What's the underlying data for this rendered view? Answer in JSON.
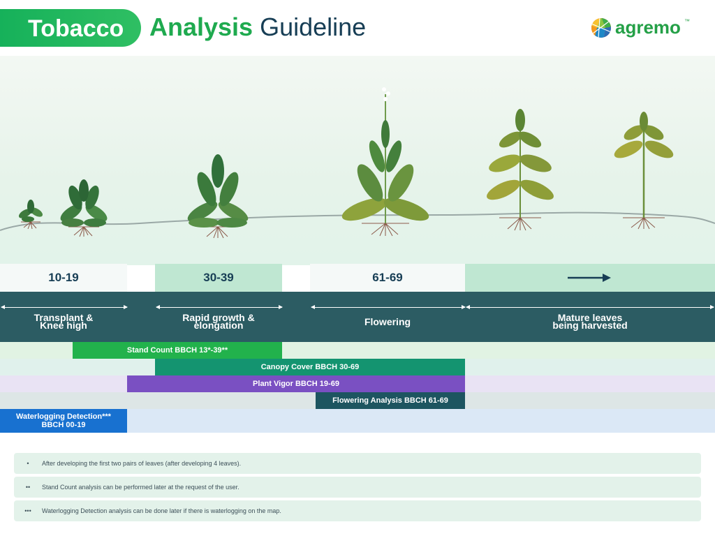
{
  "header": {
    "title_word1": "Tobacco",
    "title_word2": "Analysis",
    "title_word3": "Guideline",
    "logo_text": "agremo",
    "logo_tm": "™"
  },
  "stages": [
    {
      "code": "10-19",
      "label": "Transplant &\nKnee high"
    },
    {
      "code": "30-39",
      "label": "Rapid growth &\nelongation"
    },
    {
      "code": "61-69",
      "label": "Flowering"
    },
    {
      "code": "",
      "label": "Mature leaves\nbeing harvested"
    }
  ],
  "analyses": [
    {
      "label": "Stand Count BBCH 13*-39**",
      "color": "#22b24c",
      "row_bg": "#e1f3e3"
    },
    {
      "label": "Canopy Cover BBCH 30-69",
      "color": "#149470",
      "row_bg": "#e0f1ec"
    },
    {
      "label": "Plant Vigor BBCH 19-69",
      "color": "#7a50c2",
      "row_bg": "#e9e3f4"
    },
    {
      "label": "Flowering Analysis BBCH 61-69",
      "color": "#1d5560",
      "row_bg": "#dde6e6"
    },
    {
      "label": "Waterlogging Detection***\nBBCH 00-19",
      "color": "#1871d0",
      "row_bg": "#dbe8f6"
    }
  ],
  "notes": [
    {
      "marker": "•",
      "text": "After developing the first two pairs of leaves (after developing 4 leaves)."
    },
    {
      "marker": "••",
      "text": "Stand Count analysis can be performed later at the request of the user."
    },
    {
      "marker": "•••",
      "text": "Waterlogging Detection analysis can be done later if there is waterlogging on the map."
    }
  ],
  "colors": {
    "brand_green": "#1faa4f",
    "navy": "#173e55",
    "band": "#2c5c63"
  },
  "icons": [
    "agremo-logo-icon",
    "right-arrow-icon",
    "tobacco-plant-illustration"
  ]
}
